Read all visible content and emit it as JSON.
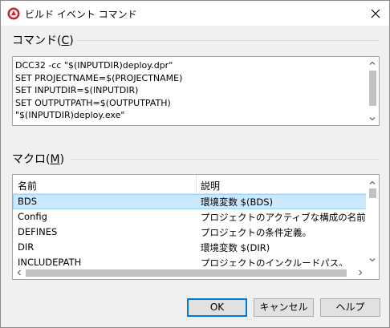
{
  "window": {
    "title": "ビルド イベント コマンド"
  },
  "command_group": {
    "label": "コマンド(",
    "mnemonic": "C",
    "label_end": ")",
    "text": "DCC32 -cc \"$(INPUTDIR)deploy.dpr\"\nSET PROJECTNAME=$(PROJECTNAME)\nSET INPUTDIR=$(INPUTDIR)\nSET OUTPUTPATH=$(OUTPUTPATH)\n\"$(INPUTDIR)deploy.exe\""
  },
  "macro_group": {
    "label": "マクロ(",
    "mnemonic": "M",
    "label_end": ")",
    "columns": [
      "名前",
      "説明"
    ],
    "rows": [
      {
        "name": "BDS",
        "description": "環境変数 $(BDS)"
      },
      {
        "name": "Config",
        "description": "プロジェクトのアクティブな構成の名前"
      },
      {
        "name": "DEFINES",
        "description": "プロジェクトの条件定義。"
      },
      {
        "name": "DIR",
        "description": "環境変数 $(DIR)"
      },
      {
        "name": "INCLUDEPATH",
        "description": "プロジェクトのインクルードパス。"
      }
    ],
    "selected_row": 0
  },
  "buttons": {
    "ok": "OK",
    "cancel": "キャンセル",
    "help": "ヘルプ"
  },
  "icons": {
    "app": "app-logo-icon",
    "close": "close-icon"
  },
  "colors": {
    "selection_bg": "#cce8ff",
    "selection_border": "#99d1ff",
    "default_button_border": "#0078d7",
    "app_icon_red": "#c4262e"
  }
}
